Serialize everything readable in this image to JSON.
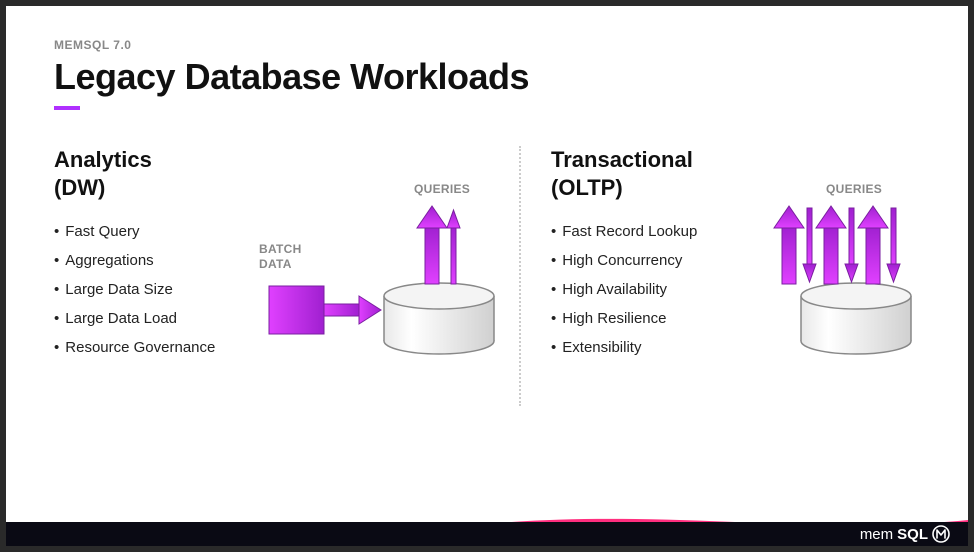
{
  "header": {
    "eyebrow": "MEMSQL 7.0",
    "title": "Legacy Database Workloads"
  },
  "left": {
    "heading_line1": "Analytics",
    "heading_line2": "(DW)",
    "bullets": [
      "Fast Query",
      "Aggregations",
      "Large Data Size",
      "Large Data Load",
      "Resource Governance"
    ],
    "label_batch_line1": "BATCH",
    "label_batch_line2": "DATA",
    "label_queries": "QUERIES"
  },
  "right": {
    "heading_line1": "Transactional",
    "heading_line2": "(OLTP)",
    "bullets": [
      "Fast Record Lookup",
      "High Concurrency",
      "High Availability",
      "High Resilience",
      "Extensibility"
    ],
    "label_queries": "QUERIES"
  },
  "brand": {
    "prefix": "mem",
    "bold": "SQL"
  },
  "colors": {
    "accent": "#b030ff"
  }
}
